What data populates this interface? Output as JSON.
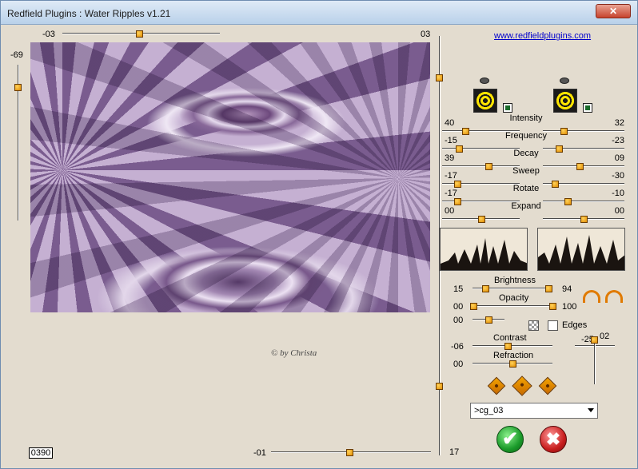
{
  "window": {
    "title": "Redfield Plugins : Water Ripples v1.21",
    "close_label": "✕"
  },
  "link": "www.redfieldplugins.com",
  "preview": {
    "top_slider_left": "-03",
    "top_slider_right": "03",
    "left_slider_value": "-69",
    "bottom_slider_value": "-01",
    "bottom_right_value": "17",
    "counter": "0390",
    "watermark": "© by Christa"
  },
  "params": [
    {
      "name": "Intensity",
      "left": "40",
      "right": "32",
      "left_pos": 0.3,
      "right_pos": 0.25
    },
    {
      "name": "Frequency",
      "left": "-15",
      "right": "-23",
      "left_pos": 0.22,
      "right_pos": 0.2
    },
    {
      "name": "Decay",
      "left": "39",
      "right": "09",
      "left_pos": 0.6,
      "right_pos": 0.45
    },
    {
      "name": "Sweep",
      "left": "-17",
      "right": "-30",
      "left_pos": 0.2,
      "right_pos": 0.15
    },
    {
      "name": "Rotate",
      "left": "-17",
      "right": "-10",
      "left_pos": 0.2,
      "right_pos": 0.3
    },
    {
      "name": "Expand",
      "left": "00",
      "right": "00",
      "left_pos": 0.5,
      "right_pos": 0.5
    }
  ],
  "lower": {
    "brightness_label": "Brightness",
    "brightness_left": "15",
    "brightness_right": "94",
    "opacity_label": "Opacity",
    "opacity_left": "00",
    "opacity_right": "100",
    "extra_value": "00",
    "edges_label": "Edges",
    "contrast_label": "Contrast",
    "contrast_value": "-06",
    "refraction_label": "Refraction",
    "refraction_value": "00",
    "vert_left": "-25",
    "vert_right": "02"
  },
  "preset": {
    "selected": ">cg_03"
  },
  "icons": {
    "eye": "eye-icon",
    "ok": "ok-icon",
    "cancel": "cancel-icon",
    "random": "dice-icon",
    "arrows": "arrow-icon"
  }
}
